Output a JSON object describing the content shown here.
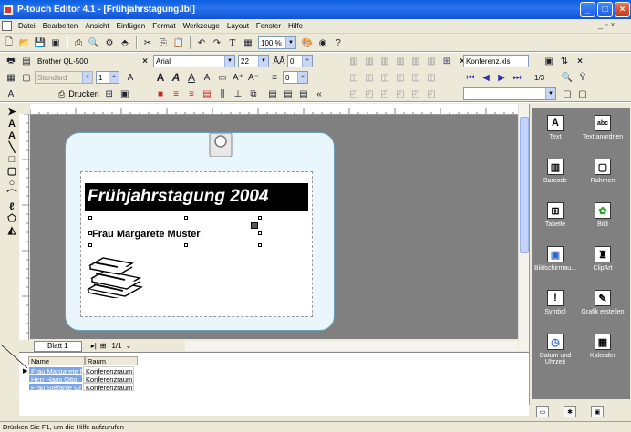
{
  "window": {
    "title": "P-touch Editor 4.1 - [Frühjahrstagung.lbl]",
    "minimize": "_",
    "maximize": "□",
    "close": "×",
    "mdi_controls": "_ ▫ ×"
  },
  "menu": [
    "Datei",
    "Bearbeiten",
    "Ansicht",
    "Einfügen",
    "Format",
    "Werkzeuge",
    "Layout",
    "Fenster",
    "Hilfe"
  ],
  "toolbar": {
    "zoom": "100 %",
    "printer": "Brother QL-500",
    "paper": "Standard",
    "copies": "1",
    "print_label": "Drucken",
    "font": "Arial",
    "font_size": "22",
    "spacing_a": "0",
    "spacing_b": "0",
    "database": "Konferenz.xls",
    "record_pos": "1/3",
    "database_filter": ""
  },
  "label": {
    "heading": "Frühjahrstagung 2004",
    "name": "Frau Margarete Muster"
  },
  "sheet": {
    "tab": "Blatt 1",
    "page": "1/1"
  },
  "grid": {
    "headers": [
      "Name",
      "Raum"
    ],
    "rows": [
      [
        "Frau Margarete Muster",
        "Konferenzraum A"
      ],
      [
        "Herr Hans Otto",
        "Konferenzraum B"
      ],
      [
        "Frau Stefanie Grün",
        "Konferenzraum C"
      ]
    ]
  },
  "objects": [
    {
      "label": "Text",
      "icon": "text-icon"
    },
    {
      "label": "Text anordnen",
      "icon": "arrange-text-icon"
    },
    {
      "label": "Barcode",
      "icon": "barcode-icon"
    },
    {
      "label": "Rahmen",
      "icon": "frame-icon"
    },
    {
      "label": "Tabelle",
      "icon": "table-icon"
    },
    {
      "label": "Bild",
      "icon": "image-icon"
    },
    {
      "label": "Bildschirmau...",
      "icon": "screenshot-icon"
    },
    {
      "label": "ClipArt",
      "icon": "clipart-icon"
    },
    {
      "label": "Symbol",
      "icon": "symbol-icon"
    },
    {
      "label": "Grafik erstellen",
      "icon": "create-graphic-icon"
    },
    {
      "label": "Datum und Uhrzeit",
      "icon": "date-time-icon"
    },
    {
      "label": "Kalender",
      "icon": "calendar-icon"
    }
  ],
  "status": "Drücken Sie  F1, um die Hilfe aufzurufen"
}
